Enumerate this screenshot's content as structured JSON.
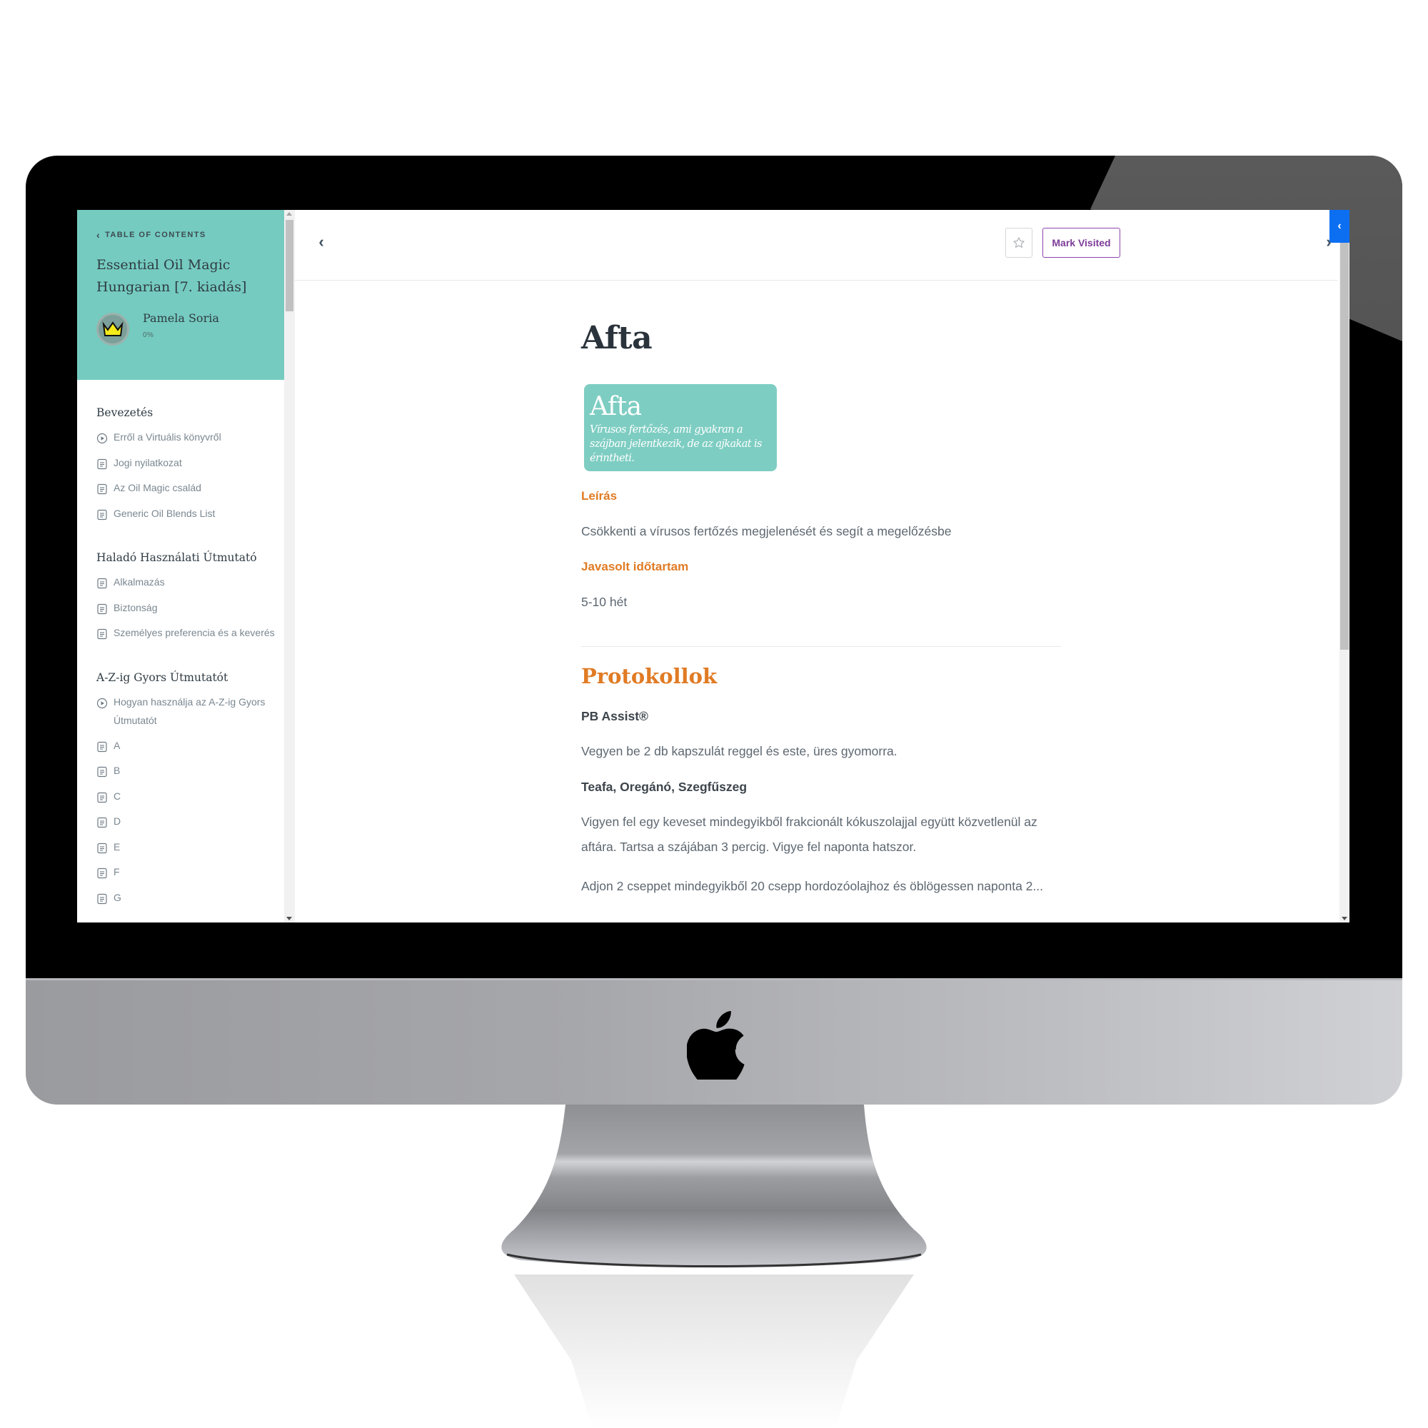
{
  "sidebar": {
    "toc_link": "TABLE OF CONTENTS",
    "book_title": "Essential Oil Magic Hungarian [7. kiadás]",
    "user": {
      "name": "Pamela Soria",
      "progress": "0%",
      "avatar_icon": "crown-icon"
    },
    "sections": [
      {
        "title": "Bevezetés",
        "items": [
          {
            "label": "Erről a Virtuális könyvről",
            "icon": "play-circle-icon"
          },
          {
            "label": "Jogi nyilatkozat",
            "icon": "document-icon"
          },
          {
            "label": "Az Oil Magic család",
            "icon": "document-icon"
          },
          {
            "label": "Generic Oil Blends List",
            "icon": "document-icon"
          }
        ]
      },
      {
        "title": "Haladó Használati Útmutató",
        "items": [
          {
            "label": "Alkalmazás",
            "icon": "document-icon"
          },
          {
            "label": "Biztonság",
            "icon": "document-icon"
          },
          {
            "label": "Személyes preferencia és a keverés",
            "icon": "document-icon"
          }
        ]
      },
      {
        "title": "A-Z-ig Gyors Útmutatót",
        "items": [
          {
            "label": "Hogyan használja az A-Z-ig Gyors Útmutatót",
            "icon": "play-circle-icon"
          },
          {
            "label": "A",
            "icon": "document-icon"
          },
          {
            "label": "B",
            "icon": "document-icon"
          },
          {
            "label": "C",
            "icon": "document-icon"
          },
          {
            "label": "D",
            "icon": "document-icon"
          },
          {
            "label": "E",
            "icon": "document-icon"
          },
          {
            "label": "F",
            "icon": "document-icon"
          },
          {
            "label": "G",
            "icon": "document-icon"
          }
        ]
      }
    ]
  },
  "topbar": {
    "prev_icon": "‹",
    "next_icon": "›",
    "mark_visited_label": "Mark Visited",
    "panel_toggle_icon": "‹"
  },
  "content": {
    "title": "Afta",
    "hero": {
      "title": "Afta",
      "subtitle": "Vírusos fertőzés, ami gyakran a szájban jelentkezik, de az ajkakat is érintheti."
    },
    "description_label": "Leírás",
    "description_text": "Csökkenti a vírusos fertőzés megjelenését és segít a megelőzésbe",
    "duration_label": "Javasolt időtartam",
    "duration_text": "5-10 hét",
    "protocols_title": "Protokollok",
    "protocols": [
      {
        "name": "PB Assist®",
        "text": "Vegyen be 2 db kapszulát reggel és este, üres gyomorra."
      },
      {
        "name": "Teafa, Oregánó, Szegfűszeg",
        "text": "Vigyen fel egy keveset mindegyikből frakcionált kókuszolajjal együtt közvetlenül az aftára. Tartsa a szájában 3 percig. Vigye fel naponta hatszor."
      }
    ],
    "truncated_text": "Adjon 2 cseppet mindegyikből 20 csepp hordozóolajhoz és öblögessen naponta 2..."
  },
  "colors": {
    "sidebar_header": "#75cbc0",
    "hero_card": "#7ecdc2",
    "accent_orange": "#e07b24",
    "mark_visited": "#8e44ad",
    "panel_tab": "#0c6ff2",
    "crown": "#f5eb1a"
  }
}
